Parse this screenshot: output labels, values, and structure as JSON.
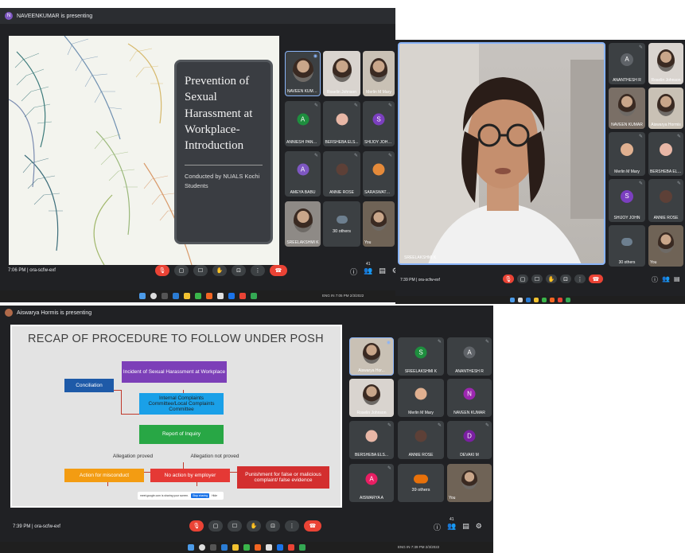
{
  "panel1": {
    "presenter": "NAVEENKUMAR is presenting",
    "presenter_initial": "N",
    "slide_title": "Prevention of Sexual Harassment at Workplace- Introduction",
    "slide_sub": "Conducted by NUALS Kochi Students",
    "time": "7:06 PM",
    "code": "ora-scfw-exf",
    "tiles": [
      {
        "name": "NAVEEN KUMAR",
        "type": "video"
      },
      {
        "name": "Roselin Johnson",
        "type": "video"
      },
      {
        "name": "Merlin M Mary",
        "type": "video"
      },
      {
        "name": "ANNIESH PAND...",
        "type": "avatar",
        "initial": "A",
        "color": "#1e8e3e"
      },
      {
        "name": "BERSHEBA ELS...",
        "type": "photo"
      },
      {
        "name": "SHIJOY JOHN...",
        "type": "avatar",
        "initial": "S",
        "color": "#7b3fbf"
      },
      {
        "name": "AMEYA BABU",
        "type": "avatar",
        "initial": "A",
        "color": "#7e57c2"
      },
      {
        "name": "ANNIE ROSE",
        "type": "photo"
      },
      {
        "name": "SARASWATHY P",
        "type": "photo"
      },
      {
        "name": "SREELAKSHMI K",
        "type": "video"
      },
      {
        "name": "30 others",
        "type": "others"
      },
      {
        "name": "You",
        "type": "video"
      }
    ],
    "tray": "ENG IN 7:05 PM 2/3/2022",
    "count": "41"
  },
  "panel2": {
    "speaker_label": "SREELAKSHMI K",
    "time": "7:39 PM",
    "code": "ora-scfw-exf",
    "tiles": [
      {
        "name": "ANANTHESH R",
        "type": "avatar",
        "initial": "A",
        "color": "#5f6368"
      },
      {
        "name": "Roselin Johnson",
        "type": "video"
      },
      {
        "name": "NAVEEN KUMAR",
        "type": "video"
      },
      {
        "name": "Aiswarya Hormis",
        "type": "video"
      },
      {
        "name": "Merlin M Mary",
        "type": "photo"
      },
      {
        "name": "BERSHEBA ELSA",
        "type": "photo"
      },
      {
        "name": "SHIJOY JOHN",
        "type": "avatar",
        "initial": "S",
        "color": "#7b3fbf"
      },
      {
        "name": "ANNIE ROSE",
        "type": "photo"
      },
      {
        "name": "30 others",
        "type": "others"
      },
      {
        "name": "You",
        "type": "video"
      }
    ],
    "tray": "ENG IN 7:39 PM 2/3/2022",
    "count": "41"
  },
  "panel3": {
    "presenter": "Aiswarya Hormis is presenting",
    "slide_title": "RECAP OF PROCEDURE TO FOLLOW UNDER POSH",
    "boxes": {
      "incident": "Incident of Sexual Harassment at Workplace",
      "conciliation": "Conciliation",
      "icc": "Internal Complaints Committee/Local Complaints Committee",
      "report": "Report of Inquiry",
      "proved": "Allegation proved",
      "not_proved": "Allegation not proved",
      "misconduct": "Action for misconduct",
      "no_action": "No action by employer",
      "punishment": "Punishment for false or malicious complaint/ false evidence"
    },
    "share_bar": "meet.google.com is sharing your screen.",
    "share_stop": "Stop sharing",
    "share_hide": "Hide",
    "time": "7:39 PM",
    "code": "ora-scfw-exf",
    "tiles": [
      {
        "name": "Aiswarya Hor...",
        "type": "video"
      },
      {
        "name": "SREELAKSHMI K",
        "type": "avatar",
        "initial": "S",
        "color": "#1e8e3e"
      },
      {
        "name": "ANANTHESH R",
        "type": "avatar",
        "initial": "A",
        "color": "#5f6368"
      },
      {
        "name": "Roselin Johnson",
        "type": "video"
      },
      {
        "name": "Merlin M Mary",
        "type": "photo"
      },
      {
        "name": "NAVEEN KUMAR",
        "type": "avatar",
        "initial": "N",
        "color": "#9c27b0"
      },
      {
        "name": "BERSHEBA ELS...",
        "type": "photo"
      },
      {
        "name": "ANNIE ROSE",
        "type": "photo"
      },
      {
        "name": "DEVAKI M",
        "type": "avatar",
        "initial": "D",
        "color": "#7b1fa2"
      },
      {
        "name": "AISWARYA A",
        "type": "avatar",
        "initial": "A",
        "color": "#e91e63"
      },
      {
        "name": "39 others",
        "type": "others"
      },
      {
        "name": "You",
        "type": "video"
      }
    ],
    "tray": "ENG IN 7:39 PM 2/3/2022",
    "count": "41"
  }
}
